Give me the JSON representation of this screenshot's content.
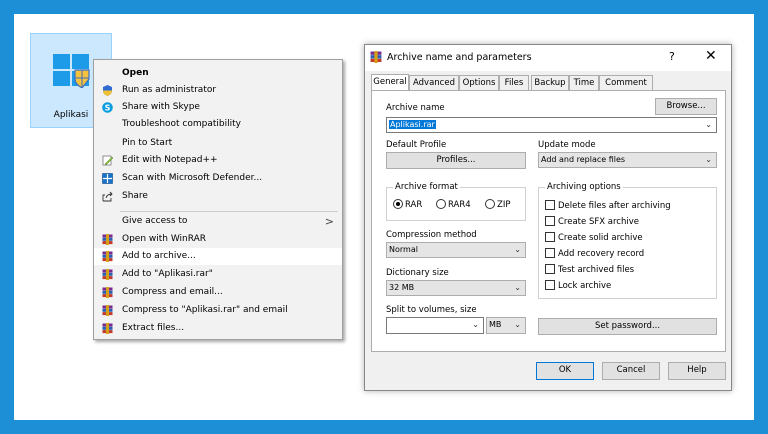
{
  "desktop": {
    "icon_label": "Aplikasi"
  },
  "context_menu": {
    "items": [
      {
        "label": "Open",
        "icon": "none"
      },
      {
        "label": "Run as administrator",
        "icon": "shield-icon"
      },
      {
        "label": "Share with Skype",
        "icon": "skype-icon"
      },
      {
        "label": "Troubleshoot compatibility",
        "icon": "none"
      },
      {
        "label": "Pin to Start",
        "icon": "none"
      },
      {
        "label": "Edit with Notepad++",
        "icon": "notepad-icon"
      },
      {
        "label": "Scan with Microsoft Defender...",
        "icon": "defender-icon"
      },
      {
        "label": "Share",
        "icon": "share-icon"
      },
      {
        "label": "Give access to",
        "icon": "none"
      },
      {
        "label": "Open with WinRAR",
        "icon": "winrar-icon"
      },
      {
        "label": "Add to archive...",
        "icon": "winrar-icon"
      },
      {
        "label": "Add to \"Aplikasi.rar\"",
        "icon": "winrar-icon"
      },
      {
        "label": "Compress and email...",
        "icon": "winrar-icon"
      },
      {
        "label": "Compress to \"Aplikasi.rar\" and email",
        "icon": "winrar-icon"
      },
      {
        "label": "Extract files...",
        "icon": "winrar-icon"
      }
    ],
    "submenu_arrow": ">"
  },
  "dialog": {
    "title": "Archive name and parameters",
    "help": "?",
    "close": "✕",
    "tabs": [
      "General",
      "Advanced",
      "Options",
      "Files",
      "Backup",
      "Time",
      "Comment"
    ],
    "archive_name_label": "Archive name",
    "browse_label": "Browse...",
    "archive_name_value": "Aplikasi.rar",
    "default_profile_label": "Default Profile",
    "profiles_label": "Profiles...",
    "update_mode_label": "Update mode",
    "update_mode_value": "Add and replace files",
    "archive_format_label": "Archive format",
    "formats": [
      "RAR",
      "RAR4",
      "ZIP"
    ],
    "archiving_options_label": "Archiving options",
    "options": [
      "Delete files after archiving",
      "Create SFX archive",
      "Create solid archive",
      "Add recovery record",
      "Test archived files",
      "Lock archive"
    ],
    "compression_label": "Compression method",
    "compression_value": "Normal",
    "dictionary_label": "Dictionary size",
    "dictionary_value": "32 MB",
    "split_label": "Split to volumes, size",
    "split_unit": "MB",
    "set_password_label": "Set password...",
    "ok_label": "OK",
    "cancel_label": "Cancel",
    "help_label": "Help"
  }
}
